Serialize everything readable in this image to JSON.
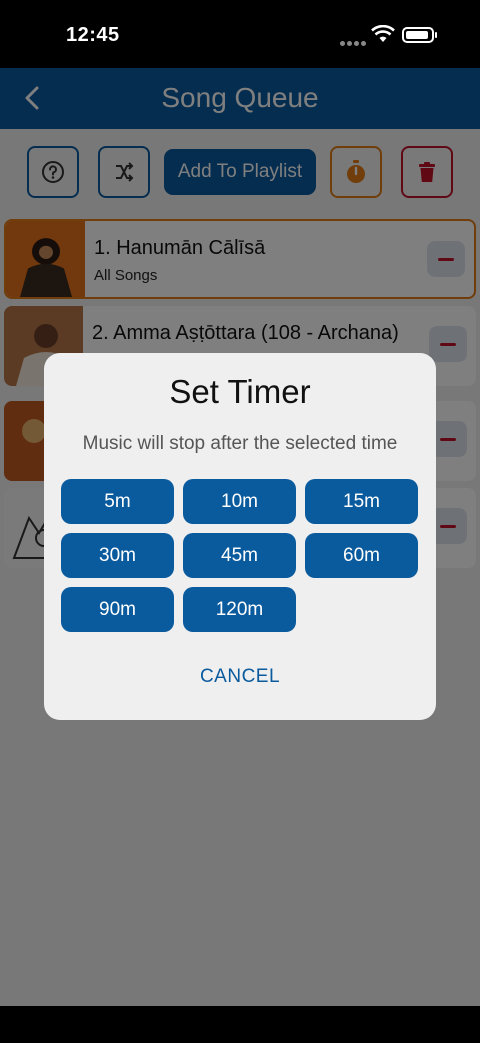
{
  "status_bar": {
    "time": "12:45"
  },
  "header": {
    "title": "Song Queue"
  },
  "toolbar": {
    "add_to_playlist_label": "Add To Playlist"
  },
  "queue": {
    "songs": [
      {
        "title": "1. Hanumān Cālīsā",
        "subtitle": "All Songs",
        "active": true
      },
      {
        "title": "2. Amma Aṣṭōttara (108 - Archana)",
        "subtitle": "",
        "active": false
      }
    ]
  },
  "timer_dialog": {
    "title": "Set Timer",
    "message": "Music will stop after the selected time",
    "options": [
      "5m",
      "10m",
      "15m",
      "30m",
      "45m",
      "60m",
      "90m",
      "120m"
    ],
    "cancel_label": "CANCEL"
  },
  "colors": {
    "primary": "#0a5a9e",
    "accent_orange": "#e07b16",
    "danger_red": "#c0122b",
    "overlay": "rgba(0,0,0,0.5)"
  }
}
